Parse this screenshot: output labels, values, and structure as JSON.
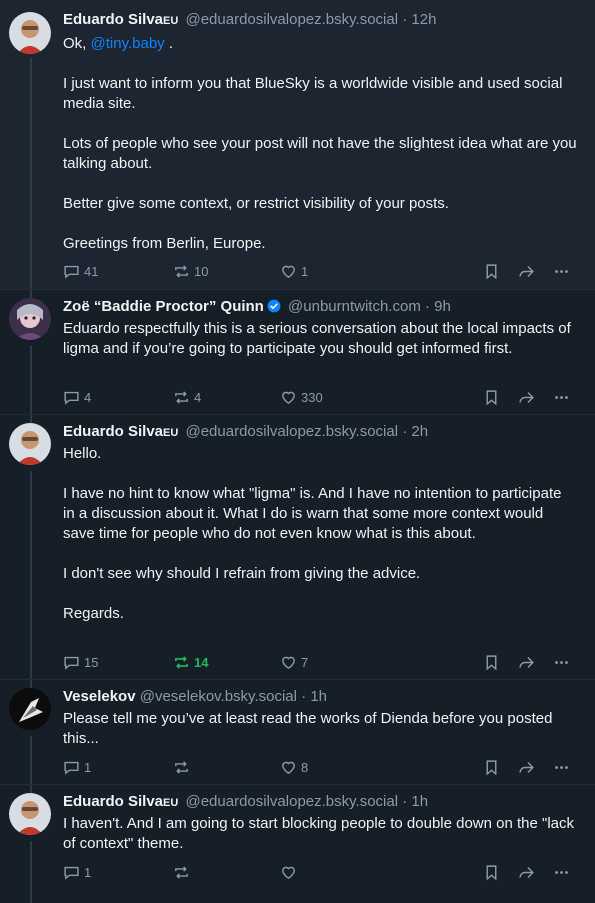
{
  "posts": [
    {
      "name": "Eduardo Silva",
      "badge": "EU",
      "handle": "@eduardosilvalopez.bsky.social",
      "sep": "·",
      "time": "12h",
      "lines": [
        "Ok, ",
        "I just want to inform you that BlueSky is a worldwide visible and used social media site.",
        "Lots of people who see your post will not have the slightest idea what are you talking about.",
        "Better give some context, or restrict visibility of your posts.",
        "Greetings from Berlin, Europe."
      ],
      "mention": "@tiny.baby",
      "mention_suffix": " .",
      "replies": "41",
      "reposts": "10",
      "likes": "1"
    },
    {
      "name": "Zoë “Baddie Proctor” Quinn",
      "handle": "@unburntwitch.com",
      "sep": "·",
      "time": "9h",
      "text": "Eduardo respectfully this is a serious conversation about the local impacts of ligma and if you’re going to participate you should get informed first.",
      "replies": "4",
      "reposts": "4",
      "likes": "330"
    },
    {
      "name": "Eduardo Silva",
      "badge": "EU",
      "handle": "@eduardosilvalopez.bsky.social",
      "sep": "·",
      "time": "2h",
      "lines": [
        "Hello.",
        "I have no hint to know what \"ligma\" is. And I have no intention to participate in a discussion about it. What I do is warn that some more context would save time for people who do not even know what is this about.",
        "I don't see why should I refrain from giving the advice.",
        "Regards."
      ],
      "replies": "15",
      "reposts": "14",
      "likes": "7"
    },
    {
      "name": "Veselekov",
      "handle": "@veselekov.bsky.social",
      "sep": "·",
      "time": "1h",
      "text": "Please tell me you’ve at least read the works of Dienda before you posted this...",
      "replies": "1",
      "reposts": "",
      "likes": "8"
    },
    {
      "name": "Eduardo Silva",
      "badge": "EU",
      "handle": "@eduardosilvalopez.bsky.social",
      "sep": "·",
      "time": "1h",
      "text": "I haven't. And I am going to start blocking people to double down on the \"lack of context\" theme.",
      "replies": "1",
      "reposts": "",
      "likes": ""
    }
  ],
  "icons": {
    "reply": "speech-bubble-icon",
    "repost": "repost-arrows-icon",
    "like": "heart-icon",
    "bookmark": "bookmark-icon",
    "share": "share-arrow-icon",
    "more": "ellipsis-icon",
    "verified": "verified-check-icon"
  },
  "colors": {
    "background": "#161e27",
    "highlight_background": "#1c2530",
    "text": "#f1f3f5",
    "muted": "#8d9aab",
    "link": "#1083fe",
    "repost_active": "#20bc5a",
    "verified": "#1083fe"
  }
}
